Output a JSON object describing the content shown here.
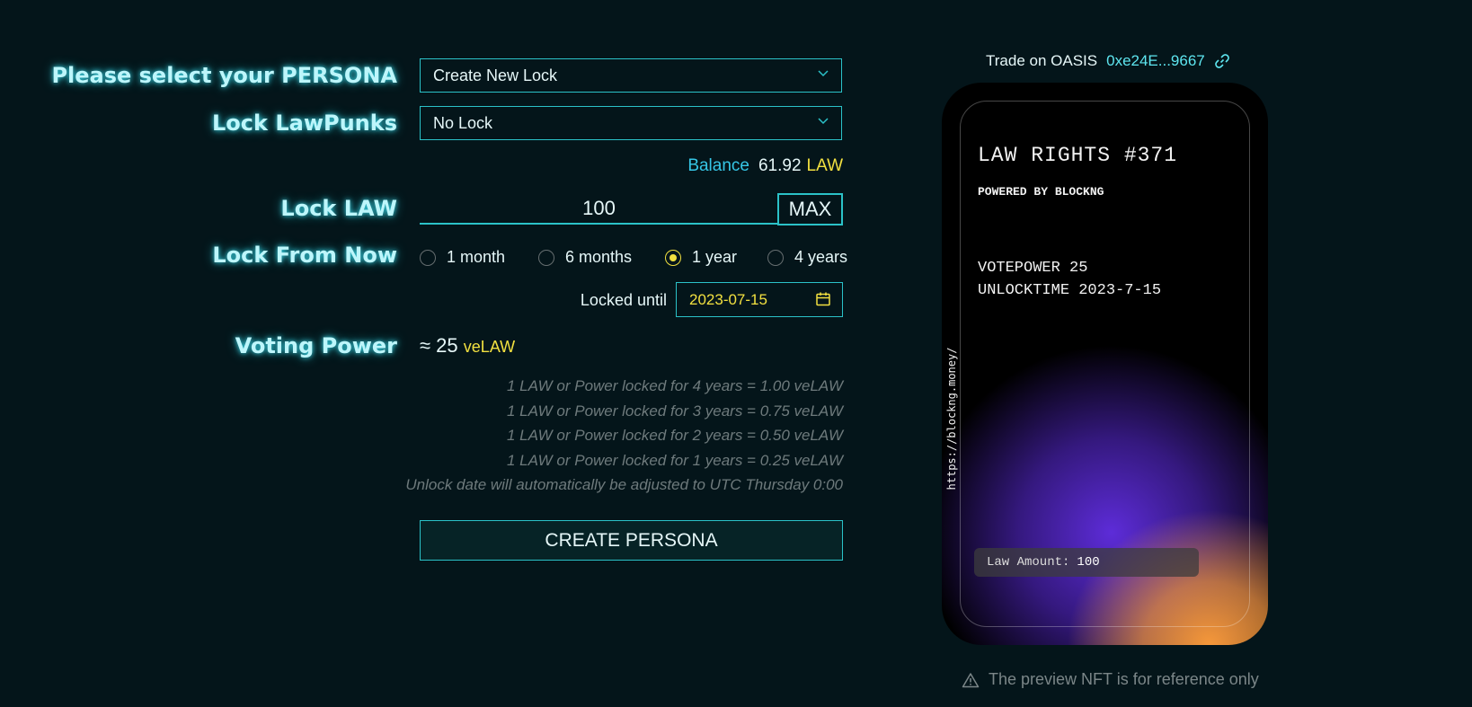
{
  "form": {
    "persona_label": "Please select your PERSONA",
    "persona_value": "Create New Lock",
    "lawpunks_label": "Lock LawPunks",
    "lawpunks_value": "No Lock",
    "balance_label": "Balance",
    "balance_value": "61.92",
    "balance_unit": "LAW",
    "lock_law_label": "Lock LAW",
    "lock_law_value": "100",
    "max_label": "MAX",
    "lock_from_now_label": "Lock From Now",
    "durations": [
      {
        "label": "1 month",
        "selected": false
      },
      {
        "label": "6 months",
        "selected": false
      },
      {
        "label": "1 year",
        "selected": true
      },
      {
        "label": "4 years",
        "selected": false
      }
    ],
    "locked_until_label": "Locked until",
    "locked_until_value": "2023-07-15",
    "voting_power_label": "Voting Power",
    "voting_power_value": "≈ 25",
    "voting_power_unit": "veLAW",
    "notes": [
      "1 LAW or Power locked for 4 years = 1.00 veLAW",
      "1 LAW or Power locked for 3 years = 0.75 veLAW",
      "1 LAW or Power locked for 2 years = 0.50 veLAW",
      "1 LAW or Power locked for 1 years = 0.25 veLAW",
      "Unlock date will automatically be adjusted to UTC Thursday 0:00"
    ],
    "create_button": "CREATE PERSONA"
  },
  "preview": {
    "trade_label": "Trade on OASIS",
    "trade_address": "0xe24E...9667",
    "card_title": "LAW RIGHTS #371",
    "card_subtitle": "POWERED BY BLOCKNG",
    "votepower_line": "VOTEPOWER 25",
    "unlocktime_line": "UNLOCKTIME 2023-7-15",
    "vertical_url": "https://blockng.money/",
    "amount_label": "Law Amount:",
    "amount_value": "100",
    "warning": "The preview NFT is for reference only"
  },
  "colors": {
    "background": "#04151a",
    "accent": "#2bc2c8",
    "highlight": "#f2e040"
  },
  "icons": [
    "chevron-down-icon",
    "calendar-icon",
    "link-icon",
    "warning-icon"
  ]
}
